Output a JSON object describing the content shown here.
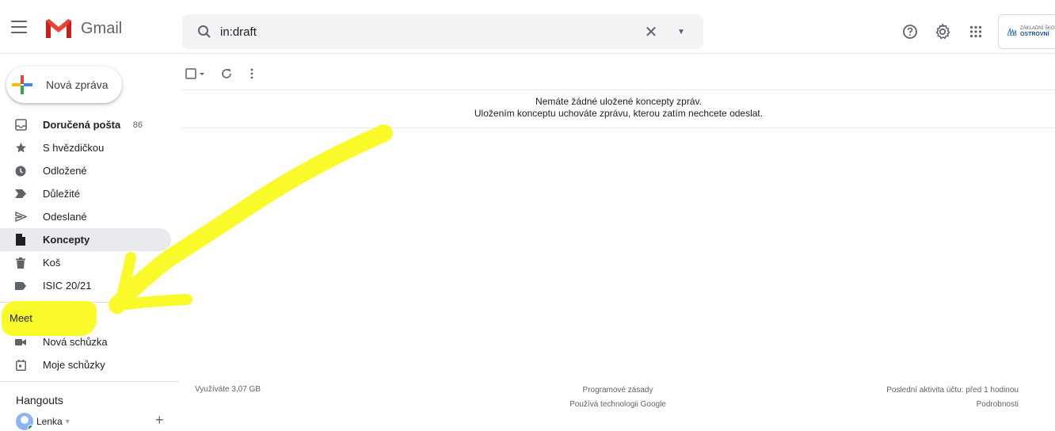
{
  "header": {
    "app_name": "Gmail",
    "search_value": "in:draft",
    "clear_symbol": "✕",
    "options_symbol": "▼"
  },
  "account": {
    "org_line1": "ZÁKLADNÍ ŠKOLA",
    "org_line2": "OSTROVNÍ"
  },
  "compose": {
    "label": "Nová zpráva"
  },
  "nav": {
    "items": [
      {
        "label": "Doručená pošta",
        "count": "86",
        "icon": "inbox-icon"
      },
      {
        "label": "S hvězdičkou",
        "icon": "star-icon"
      },
      {
        "label": "Odložené",
        "icon": "clock-icon"
      },
      {
        "label": "Důležité",
        "icon": "important-icon"
      },
      {
        "label": "Odeslané",
        "icon": "send-icon"
      },
      {
        "label": "Koncepty",
        "icon": "draft-icon"
      },
      {
        "label": "Koš",
        "icon": "trash-icon"
      },
      {
        "label": "ISIC 20/21",
        "icon": "label-icon"
      }
    ]
  },
  "meet": {
    "title": "Meet",
    "items": [
      {
        "label": "Nová schůzka",
        "icon": "video-icon"
      },
      {
        "label": "Moje schůzky",
        "icon": "calendar-icon"
      }
    ]
  },
  "hangouts": {
    "title": "Hangouts",
    "user": "Lenka",
    "dropdown": "▾",
    "add_symbol": "+"
  },
  "main": {
    "empty_line1": "Nemáte žádné uložené koncepty zpráv.",
    "empty_line2": "Uložením konceptu uchováte zprávu, kterou zatím nechcete odeslat."
  },
  "footer": {
    "storage": "Využíváte 3,07 GB",
    "policies": "Programové zásady",
    "powered": "Používá technologii Google",
    "activity": "Poslední aktivita účtu: před 1 hodinou",
    "details": "Podrobnosti"
  },
  "colors": {
    "annotation": "#fafa2a",
    "active_bg": "#e8eaed"
  }
}
